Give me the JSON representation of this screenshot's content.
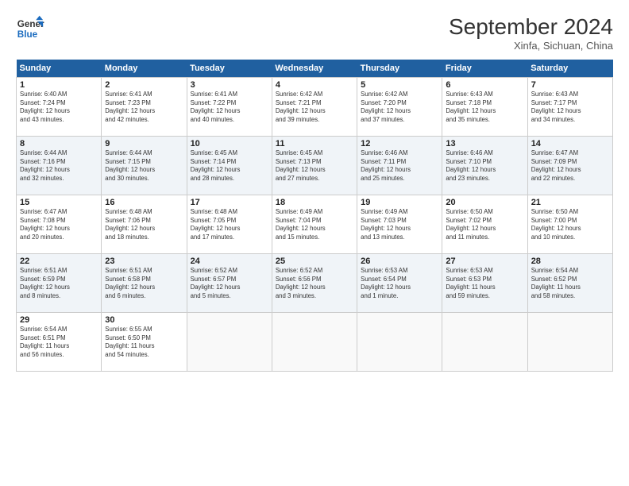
{
  "logo": {
    "line1": "General",
    "line2": "Blue",
    "icon_color": "#1a6bbf"
  },
  "title": "September 2024",
  "subtitle": "Xinfa, Sichuan, China",
  "headers": [
    "Sunday",
    "Monday",
    "Tuesday",
    "Wednesday",
    "Thursday",
    "Friday",
    "Saturday"
  ],
  "weeks": [
    [
      {
        "day": "1",
        "info": "Sunrise: 6:40 AM\nSunset: 7:24 PM\nDaylight: 12 hours\nand 43 minutes."
      },
      {
        "day": "2",
        "info": "Sunrise: 6:41 AM\nSunset: 7:23 PM\nDaylight: 12 hours\nand 42 minutes."
      },
      {
        "day": "3",
        "info": "Sunrise: 6:41 AM\nSunset: 7:22 PM\nDaylight: 12 hours\nand 40 minutes."
      },
      {
        "day": "4",
        "info": "Sunrise: 6:42 AM\nSunset: 7:21 PM\nDaylight: 12 hours\nand 39 minutes."
      },
      {
        "day": "5",
        "info": "Sunrise: 6:42 AM\nSunset: 7:20 PM\nDaylight: 12 hours\nand 37 minutes."
      },
      {
        "day": "6",
        "info": "Sunrise: 6:43 AM\nSunset: 7:18 PM\nDaylight: 12 hours\nand 35 minutes."
      },
      {
        "day": "7",
        "info": "Sunrise: 6:43 AM\nSunset: 7:17 PM\nDaylight: 12 hours\nand 34 minutes."
      }
    ],
    [
      {
        "day": "8",
        "info": "Sunrise: 6:44 AM\nSunset: 7:16 PM\nDaylight: 12 hours\nand 32 minutes."
      },
      {
        "day": "9",
        "info": "Sunrise: 6:44 AM\nSunset: 7:15 PM\nDaylight: 12 hours\nand 30 minutes."
      },
      {
        "day": "10",
        "info": "Sunrise: 6:45 AM\nSunset: 7:14 PM\nDaylight: 12 hours\nand 28 minutes."
      },
      {
        "day": "11",
        "info": "Sunrise: 6:45 AM\nSunset: 7:13 PM\nDaylight: 12 hours\nand 27 minutes."
      },
      {
        "day": "12",
        "info": "Sunrise: 6:46 AM\nSunset: 7:11 PM\nDaylight: 12 hours\nand 25 minutes."
      },
      {
        "day": "13",
        "info": "Sunrise: 6:46 AM\nSunset: 7:10 PM\nDaylight: 12 hours\nand 23 minutes."
      },
      {
        "day": "14",
        "info": "Sunrise: 6:47 AM\nSunset: 7:09 PM\nDaylight: 12 hours\nand 22 minutes."
      }
    ],
    [
      {
        "day": "15",
        "info": "Sunrise: 6:47 AM\nSunset: 7:08 PM\nDaylight: 12 hours\nand 20 minutes."
      },
      {
        "day": "16",
        "info": "Sunrise: 6:48 AM\nSunset: 7:06 PM\nDaylight: 12 hours\nand 18 minutes."
      },
      {
        "day": "17",
        "info": "Sunrise: 6:48 AM\nSunset: 7:05 PM\nDaylight: 12 hours\nand 17 minutes."
      },
      {
        "day": "18",
        "info": "Sunrise: 6:49 AM\nSunset: 7:04 PM\nDaylight: 12 hours\nand 15 minutes."
      },
      {
        "day": "19",
        "info": "Sunrise: 6:49 AM\nSunset: 7:03 PM\nDaylight: 12 hours\nand 13 minutes."
      },
      {
        "day": "20",
        "info": "Sunrise: 6:50 AM\nSunset: 7:02 PM\nDaylight: 12 hours\nand 11 minutes."
      },
      {
        "day": "21",
        "info": "Sunrise: 6:50 AM\nSunset: 7:00 PM\nDaylight: 12 hours\nand 10 minutes."
      }
    ],
    [
      {
        "day": "22",
        "info": "Sunrise: 6:51 AM\nSunset: 6:59 PM\nDaylight: 12 hours\nand 8 minutes."
      },
      {
        "day": "23",
        "info": "Sunrise: 6:51 AM\nSunset: 6:58 PM\nDaylight: 12 hours\nand 6 minutes."
      },
      {
        "day": "24",
        "info": "Sunrise: 6:52 AM\nSunset: 6:57 PM\nDaylight: 12 hours\nand 5 minutes."
      },
      {
        "day": "25",
        "info": "Sunrise: 6:52 AM\nSunset: 6:56 PM\nDaylight: 12 hours\nand 3 minutes."
      },
      {
        "day": "26",
        "info": "Sunrise: 6:53 AM\nSunset: 6:54 PM\nDaylight: 12 hours\nand 1 minute."
      },
      {
        "day": "27",
        "info": "Sunrise: 6:53 AM\nSunset: 6:53 PM\nDaylight: 11 hours\nand 59 minutes."
      },
      {
        "day": "28",
        "info": "Sunrise: 6:54 AM\nSunset: 6:52 PM\nDaylight: 11 hours\nand 58 minutes."
      }
    ],
    [
      {
        "day": "29",
        "info": "Sunrise: 6:54 AM\nSunset: 6:51 PM\nDaylight: 11 hours\nand 56 minutes."
      },
      {
        "day": "30",
        "info": "Sunrise: 6:55 AM\nSunset: 6:50 PM\nDaylight: 11 hours\nand 54 minutes."
      },
      {
        "day": "",
        "info": ""
      },
      {
        "day": "",
        "info": ""
      },
      {
        "day": "",
        "info": ""
      },
      {
        "day": "",
        "info": ""
      },
      {
        "day": "",
        "info": ""
      }
    ]
  ]
}
